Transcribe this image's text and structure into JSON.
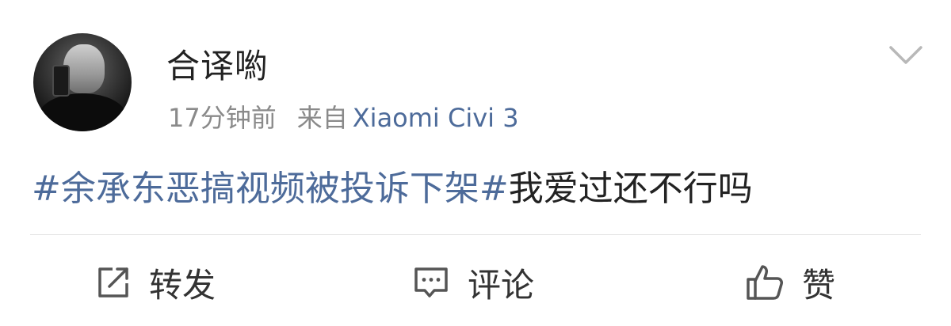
{
  "post": {
    "username": "合译喲",
    "time": "17分钟前",
    "source_label": "来自",
    "device": "Xiaomi Civi 3",
    "content": {
      "topic": "#余承东恶搞视频被投诉下架#",
      "text": "我爱过还不行吗"
    }
  },
  "actions": {
    "repost_label": "转发",
    "comment_label": "评论",
    "like_label": "赞"
  },
  "icons": {
    "more": "chevron-down-icon",
    "repost": "share-icon",
    "comment": "comment-icon",
    "like": "thumbs-up-icon"
  },
  "colors": {
    "link": "#4d6b9a",
    "meta": "#8a8a8a",
    "text": "#222222"
  }
}
